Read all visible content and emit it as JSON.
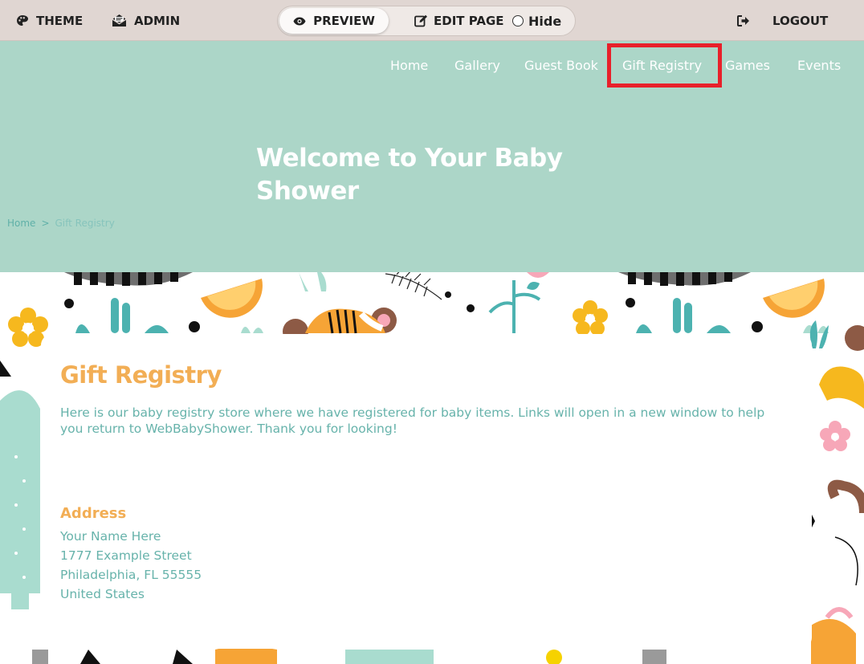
{
  "adminbar": {
    "theme_label": "THEME",
    "admin_label": "ADMIN",
    "preview_label": "PREVIEW",
    "edit_label": "EDIT PAGE",
    "hide_label": "Hide",
    "logout_label": "LOGOUT"
  },
  "nav": {
    "items": [
      "Home",
      "Gallery",
      "Guest Book",
      "Gift Registry",
      "Games",
      "Events"
    ],
    "highlighted": "Gift Registry"
  },
  "hero": {
    "title": "Welcome to Your Baby Shower"
  },
  "breadcrumb": {
    "home": "Home",
    "separator": ">",
    "current": "Gift Registry"
  },
  "content": {
    "title": "Gift Registry",
    "intro": "Here is our baby registry store where we have registered for baby items. Links will open in a new window to help you return to WebBabyShower. Thank you for looking!",
    "address_title": "Address",
    "address_lines": [
      "Your Name Here",
      "1777 Example Street",
      "Philadelphia, FL 55555",
      "United States"
    ]
  },
  "colors": {
    "adminbar_bg": "#e0d6d2",
    "hero_bg": "#acd6c8",
    "accent_orange": "#f2ae55",
    "text_teal": "#67b3ab",
    "highlight_red": "#e8202a"
  },
  "icons": {
    "theme": "palette-icon",
    "admin": "envelope-open-icon",
    "preview": "eye-icon",
    "edit": "edit-icon",
    "hide": "radio-icon",
    "logout": "sign-out-icon"
  }
}
